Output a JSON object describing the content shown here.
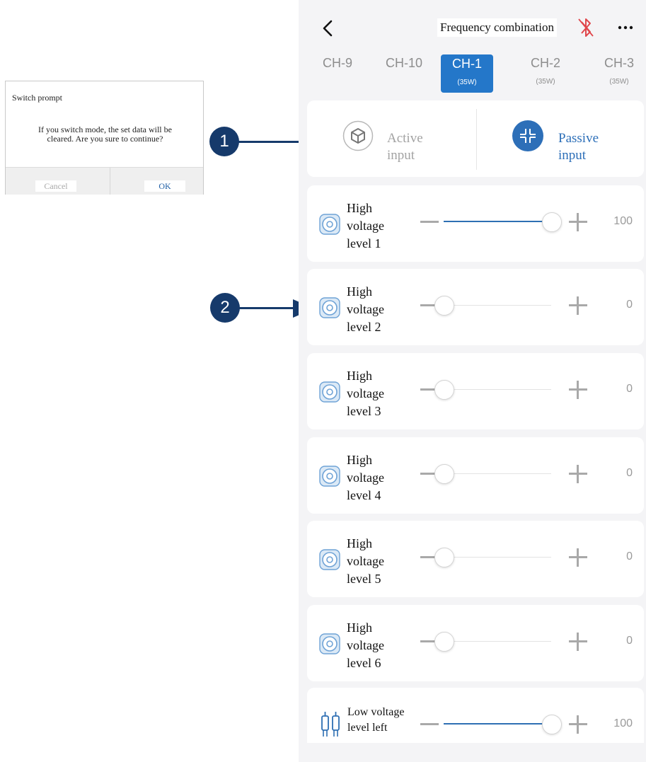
{
  "dialog": {
    "title": "Switch prompt",
    "message_line1": "If you switch mode, the set data will be",
    "message_line2": "cleared. Are you sure to continue?",
    "cancel_label": "Cancel",
    "ok_label": "OK"
  },
  "annotations": [
    "1",
    "2"
  ],
  "header": {
    "title": "Frequency combination",
    "back_icon": "chevron-left-icon",
    "bluetooth_icon": "bluetooth-off-icon",
    "more_icon": "more-horizontal-icon",
    "bluetooth_color": "#e0474c"
  },
  "tabs": [
    {
      "label": "CH-9",
      "sub": ""
    },
    {
      "label": "CH-10",
      "sub": ""
    },
    {
      "label": "CH-1",
      "sub": "(35W)",
      "active": true
    },
    {
      "label": "CH-2",
      "sub": "(35W)"
    },
    {
      "label": "CH-3",
      "sub": "(35W)"
    }
  ],
  "mode": {
    "active_line1": "Active",
    "active_line2": "input",
    "passive_line1": "Passive",
    "passive_line2": "input",
    "selected": "passive",
    "accent": "#2477c9"
  },
  "channels": [
    {
      "line1": "High",
      "line2": "voltage",
      "line3": "level 1",
      "value": "100",
      "level": 1.0
    },
    {
      "line1": "High",
      "line2": "voltage",
      "line3": "level 2",
      "value": "0",
      "level": 0
    },
    {
      "line1": "High",
      "line2": "voltage",
      "line3": "level 3",
      "value": "0",
      "level": 0
    },
    {
      "line1": "High",
      "line2": "voltage",
      "line3": "level 4",
      "value": "0",
      "level": 0
    },
    {
      "line1": "High",
      "line2": "voltage",
      "line3": "level 5",
      "value": "0",
      "level": 0
    },
    {
      "line1": "High",
      "line2": "voltage",
      "line3": "level 6",
      "value": "0",
      "level": 0
    }
  ],
  "low": {
    "line1": "Low voltage",
    "line2": "level left",
    "value": "100",
    "level": 1.0
  }
}
